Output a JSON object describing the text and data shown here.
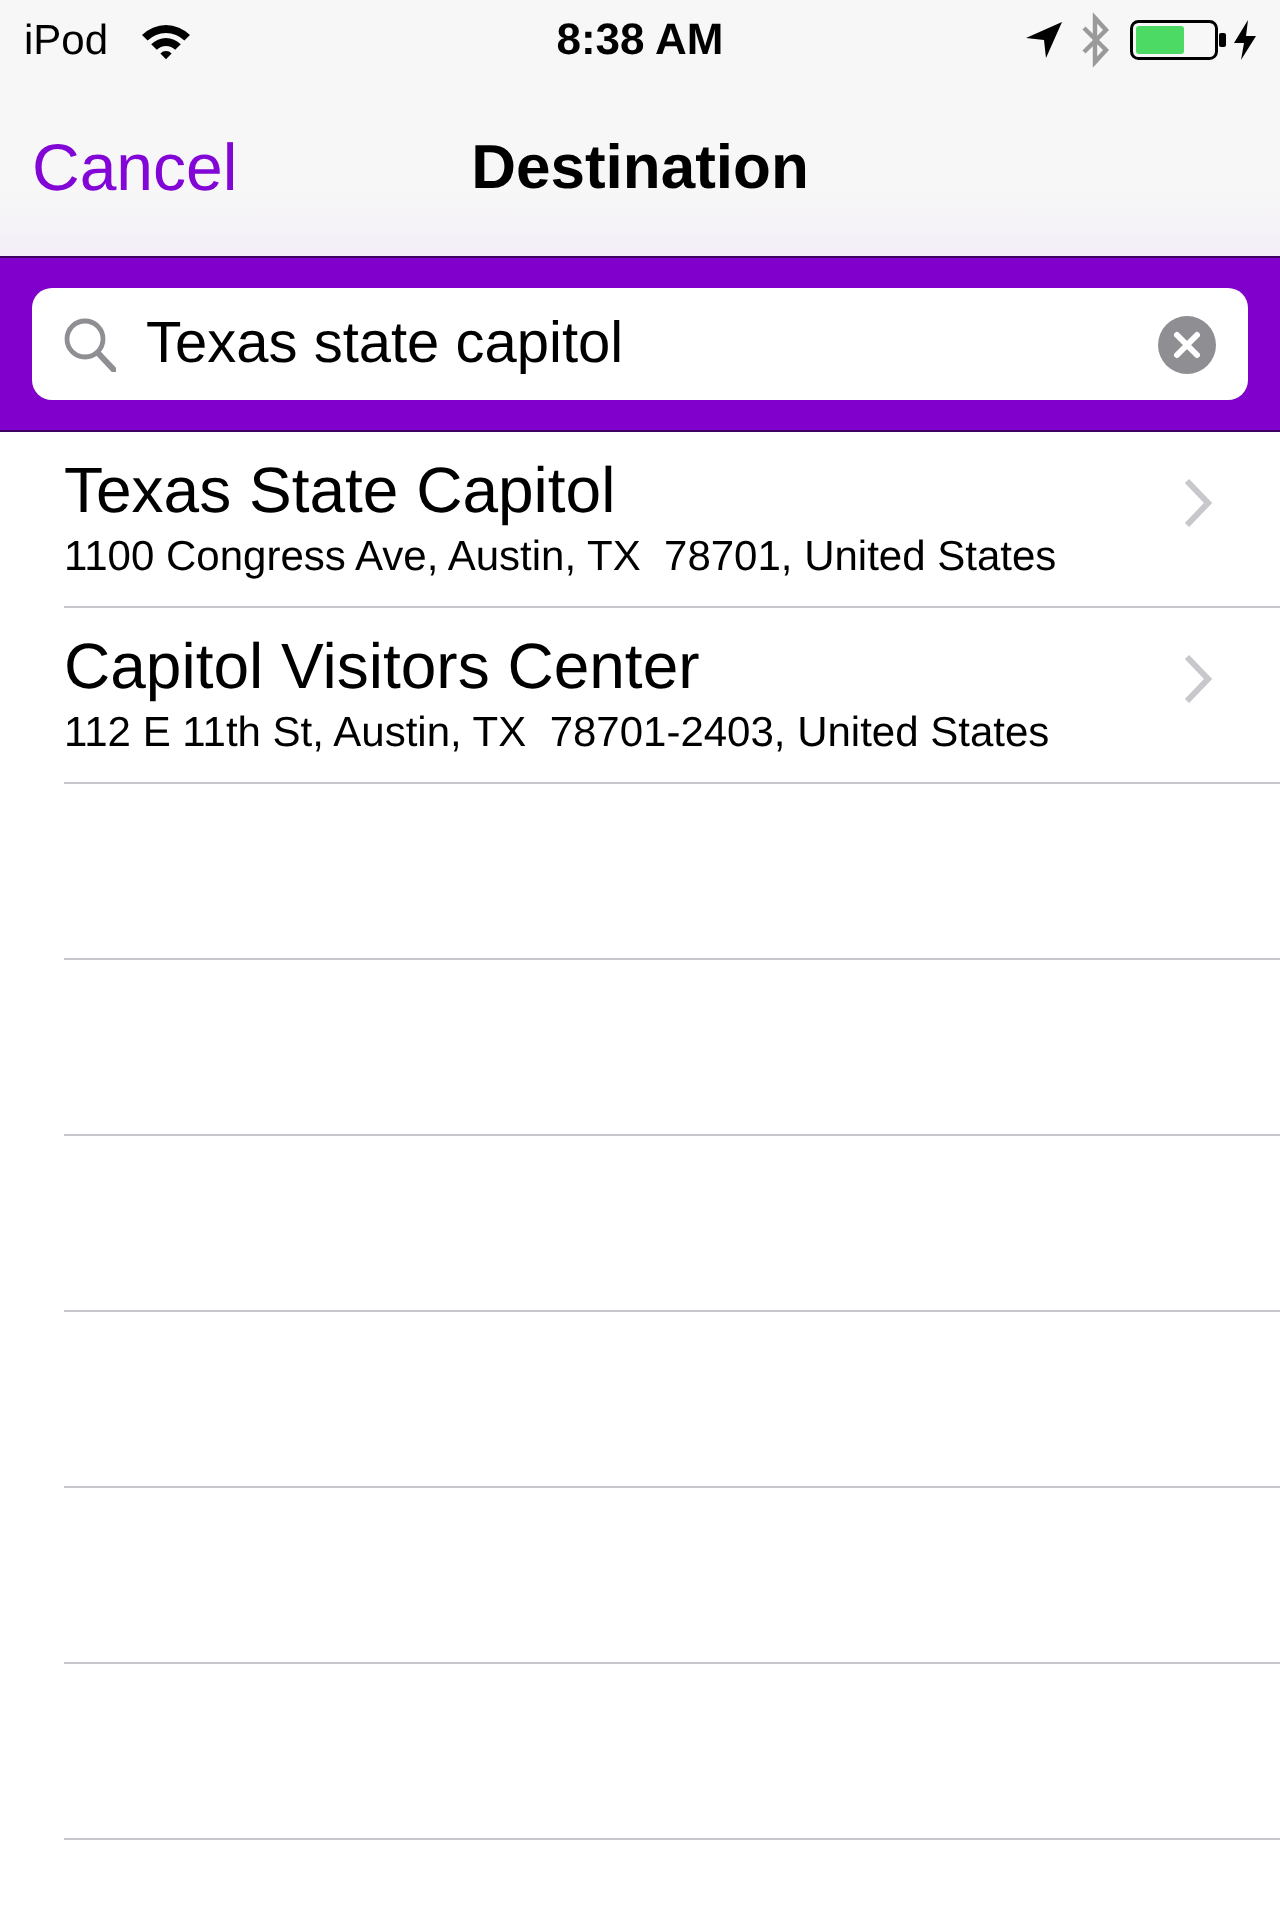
{
  "status_bar": {
    "carrier": "iPod",
    "time": "8:38 AM"
  },
  "nav_bar": {
    "left_button": "Cancel",
    "title": "Destination"
  },
  "search": {
    "value": "Texas state capitol"
  },
  "results": [
    {
      "name": "Texas State Capitol",
      "address": "1100 Congress Ave, Austin, TX  78701, United States"
    },
    {
      "name": "Capitol Visitors Center",
      "address": "112 E 11th St, Austin, TX  78701-2403, United States"
    }
  ]
}
